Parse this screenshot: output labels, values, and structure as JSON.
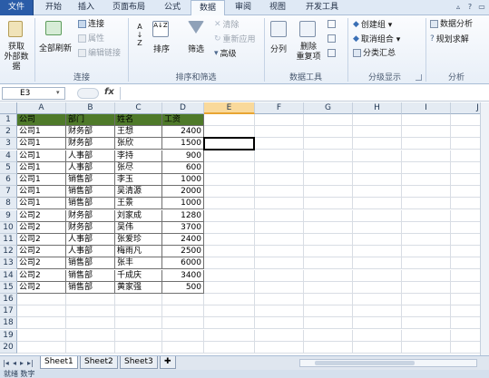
{
  "tabs": [
    "文件",
    "开始",
    "插入",
    "页面布局",
    "公式",
    "数据",
    "审阅",
    "视图",
    "开发工具"
  ],
  "active_tab": "数据",
  "ribbon": {
    "groups": [
      "连接",
      "排序和筛选",
      "数据工具",
      "分级显示",
      "分析"
    ],
    "get_external": "获取\n外部数据",
    "refresh_all": "全部刷新",
    "connection": "连接",
    "properties": "属性",
    "edit_links": "编辑链接",
    "sort_az": "A↓Z",
    "sort": "排序",
    "filter": "筛选",
    "clear": "清除",
    "reapply": "重新应用",
    "advanced": "高级",
    "split": "分列",
    "remove_dup": "删除\n重复项",
    "group": "创建组",
    "ungroup": "取消组合",
    "subtotal": "分类汇总",
    "data_analysis": "数据分析",
    "solver": "规划求解"
  },
  "formula_bar": {
    "name_box": "E3",
    "fx": "fx",
    "content": ""
  },
  "columns": [
    "A",
    "B",
    "C",
    "D",
    "E",
    "F",
    "G",
    "H",
    "I",
    "J"
  ],
  "selected_col": "E",
  "rows": [
    [
      "公司",
      "部门",
      "姓名",
      "工资"
    ],
    [
      "公司1",
      "财务部",
      "王想",
      "2400"
    ],
    [
      "公司1",
      "财务部",
      "张欣",
      "1500"
    ],
    [
      "公司1",
      "人事部",
      "李持",
      "900"
    ],
    [
      "公司1",
      "人事部",
      "张尽",
      "600"
    ],
    [
      "公司1",
      "销售部",
      "李玉",
      "1000"
    ],
    [
      "公司1",
      "销售部",
      "吴清源",
      "2000"
    ],
    [
      "公司1",
      "销售部",
      "王景",
      "1000"
    ],
    [
      "公司2",
      "财务部",
      "刘家成",
      "1280"
    ],
    [
      "公司2",
      "财务部",
      "吴伟",
      "3700"
    ],
    [
      "公司2",
      "人事部",
      "张爱珍",
      "2400"
    ],
    [
      "公司2",
      "人事部",
      "梅雨凡",
      "2500"
    ],
    [
      "公司2",
      "销售部",
      "张丰",
      "6000"
    ],
    [
      "公司2",
      "销售部",
      "千成庆",
      "3400"
    ],
    [
      "公司2",
      "销售部",
      "黄家强",
      "500"
    ]
  ],
  "row_numbers": [
    "1",
    "2",
    "3",
    "4",
    "5",
    "6",
    "7",
    "8",
    "9",
    "10",
    "11",
    "12",
    "13",
    "14",
    "15",
    "16",
    "17",
    "18",
    "19",
    "20"
  ],
  "sheet_tabs": [
    "Sheet1",
    "Sheet2",
    "Sheet3"
  ],
  "active_sheet": "Sheet1",
  "status_text": "就绪    数字",
  "colors": {
    "header_fill": "#4f7a2a",
    "file_tab": "#2a5ca8",
    "selected_col": "#f9d99b"
  }
}
